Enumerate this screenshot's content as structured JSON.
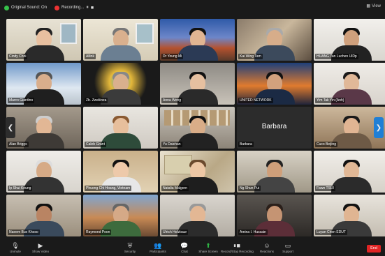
{
  "topbar": {
    "original_sound": "Original Sound: On",
    "recording": "Recording...",
    "view": "View"
  },
  "next_page_arrow": "❯",
  "prev_page_arrow": "❮",
  "participants": [
    "Cindy Choi",
    "Allink",
    "Dr Young Mi",
    "Kai Wing Tam",
    "HUANG Tan Luchen UlDp",
    "Marco Giardino",
    "Zb. Zweliinza",
    "Anna Wong",
    "UNITED NETWORK",
    "Yim Tak Yin (Anh)",
    "Alan Briggs",
    "Caleb Grant",
    "Yu Daichan",
    "Barbara",
    "Cuco Beijing",
    "Ip Shui Keung",
    "Phuong Chi Hoang, Vietnam",
    "Natalia Malgorn",
    "Ng Shun Pui",
    "Fawn TSUI",
    "Naeem Bux Khoso",
    "Raymond Poon",
    "Ulrich Holzbaur",
    "Amina I. Hussain",
    "Luyan Chen EDUT"
  ],
  "barbara_center": "Barbara",
  "toolbar": {
    "unmute": "Unmute",
    "video": "Show Video",
    "security": "Security",
    "participants": "Participants",
    "participants_count": "3",
    "chat": "Chat",
    "share": "Share Screen",
    "record": "Record/Stop Recording",
    "reactions": "Reactions",
    "more": "Support",
    "end": "End"
  }
}
